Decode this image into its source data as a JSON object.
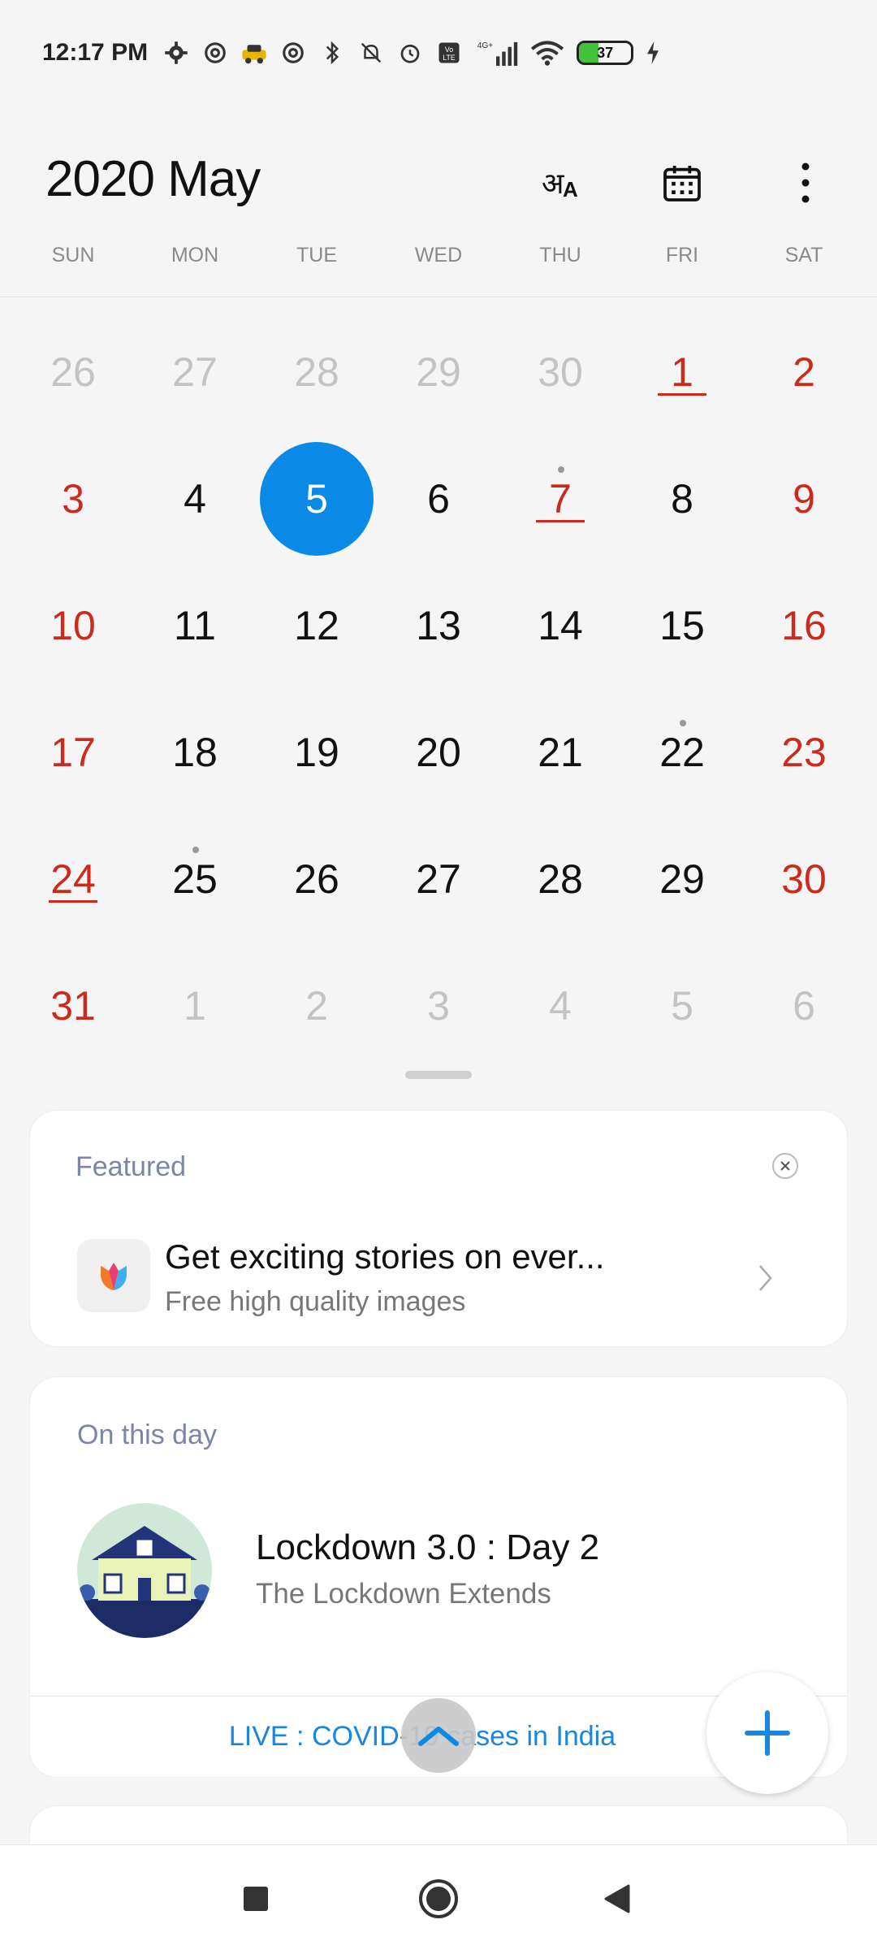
{
  "status_bar": {
    "time": "12:17 PM",
    "network": "4G+",
    "volte": "Vo LTE",
    "battery_percent": "37",
    "battery_level": 0.37,
    "icons": [
      "gear-icon",
      "at-icon",
      "taxi-icon",
      "at-icon",
      "bluetooth-icon",
      "bell-off-icon",
      "alarm-icon",
      "volte-icon",
      "signal-icon",
      "wifi-icon",
      "battery-icon",
      "charging-icon"
    ]
  },
  "header": {
    "title": "2020 May",
    "actions": [
      "language-icon",
      "calendar-icon",
      "more-vert-icon"
    ]
  },
  "weekdays": [
    "SUN",
    "MON",
    "TUE",
    "WED",
    "THU",
    "FRI",
    "SAT"
  ],
  "days": [
    {
      "n": "26",
      "muted": true
    },
    {
      "n": "27",
      "muted": true
    },
    {
      "n": "28",
      "muted": true
    },
    {
      "n": "29",
      "muted": true
    },
    {
      "n": "30",
      "muted": true
    },
    {
      "n": "1",
      "weekend": true,
      "holiday": true
    },
    {
      "n": "2",
      "weekend": true
    },
    {
      "n": "3",
      "weekend": true
    },
    {
      "n": "4"
    },
    {
      "n": "5",
      "selected": true
    },
    {
      "n": "6"
    },
    {
      "n": "7",
      "weekend": true,
      "holiday": true,
      "event": true
    },
    {
      "n": "8"
    },
    {
      "n": "9",
      "weekend": true
    },
    {
      "n": "10",
      "weekend": true
    },
    {
      "n": "11"
    },
    {
      "n": "12"
    },
    {
      "n": "13"
    },
    {
      "n": "14"
    },
    {
      "n": "15"
    },
    {
      "n": "16",
      "weekend": true
    },
    {
      "n": "17",
      "weekend": true
    },
    {
      "n": "18"
    },
    {
      "n": "19"
    },
    {
      "n": "20"
    },
    {
      "n": "21"
    },
    {
      "n": "22",
      "event": true
    },
    {
      "n": "23",
      "weekend": true
    },
    {
      "n": "24",
      "weekend": true,
      "holiday": true
    },
    {
      "n": "25",
      "event": true
    },
    {
      "n": "26"
    },
    {
      "n": "27"
    },
    {
      "n": "28"
    },
    {
      "n": "29"
    },
    {
      "n": "30",
      "weekend": true
    },
    {
      "n": "31",
      "weekend": true
    },
    {
      "n": "1",
      "muted": true
    },
    {
      "n": "2",
      "muted": true
    },
    {
      "n": "3",
      "muted": true
    },
    {
      "n": "4",
      "muted": true
    },
    {
      "n": "5",
      "muted": true
    },
    {
      "n": "6",
      "muted": true
    }
  ],
  "featured": {
    "title": "Featured",
    "headline": "Get exciting stories on ever...",
    "subtitle": "Free high quality images"
  },
  "on_this_day": {
    "title": "On this day",
    "headline": "Lockdown 3.0 : Day 2",
    "subtitle": "The Lockdown Extends",
    "link": "LIVE : COVID-19 cases in India"
  },
  "colors": {
    "accent": "#0a8ae6",
    "weekend": "#cc2a1c",
    "muted": "#c3c3c3",
    "link": "#1a86e0"
  }
}
